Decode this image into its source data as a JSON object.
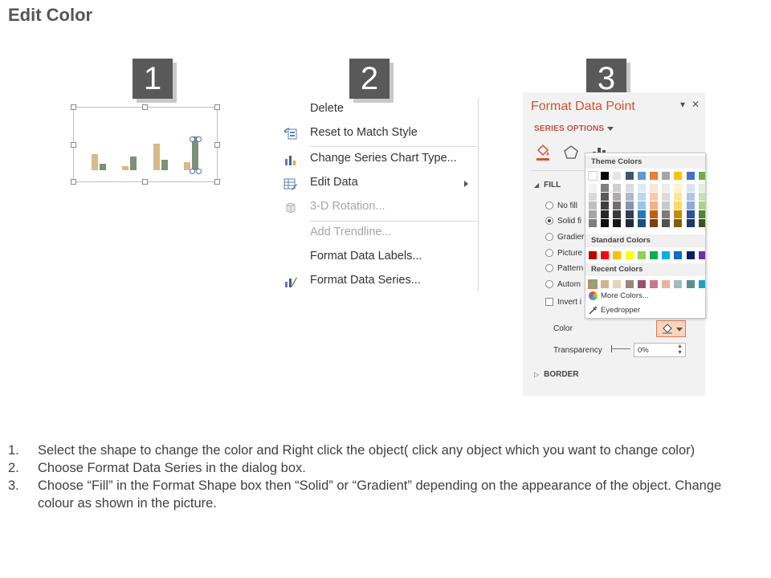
{
  "page": {
    "title": "Edit Color"
  },
  "badges": [
    "1",
    "2",
    "3"
  ],
  "context_menu": {
    "items": [
      {
        "label": "Delete",
        "icon": "none",
        "disabled": false
      },
      {
        "label": "Reset to Match Style",
        "icon": "reset-style-icon",
        "disabled": false
      },
      {
        "label": "Change Series Chart Type...",
        "icon": "chart-type-icon",
        "disabled": false
      },
      {
        "label": "Edit Data",
        "icon": "edit-data-icon",
        "disabled": false,
        "submenu": true
      },
      {
        "label": "3-D Rotation...",
        "icon": "rotation-icon",
        "disabled": true
      },
      {
        "label": "Add Trendline...",
        "icon": "none",
        "disabled": true
      },
      {
        "label": "Format Data Labels...",
        "icon": "none",
        "disabled": false
      },
      {
        "label": "Format Data Series...",
        "icon": "format-series-icon",
        "disabled": false
      }
    ]
  },
  "format_pane": {
    "title": "Format Data Point",
    "series_options": "SERIES OPTIONS",
    "fill_heading": "FILL",
    "fill_options": [
      {
        "label": "No fill",
        "selected": false
      },
      {
        "label": "Solid fi",
        "selected": true
      },
      {
        "label": "Gradier",
        "selected": false
      },
      {
        "label": "Picture",
        "selected": false
      },
      {
        "label": "Pattern",
        "selected": false
      },
      {
        "label": "Autom",
        "selected": false
      }
    ],
    "invert_label": "Invert i",
    "color_label": "Color",
    "transparency_label": "Transparency",
    "transparency_value": "0%",
    "border_heading": "BORDER",
    "accent_color": "#d35230"
  },
  "color_dropdown": {
    "theme_heading": "Theme Colors",
    "standard_heading": "Standard Colors",
    "recent_heading": "Recent Colors",
    "more_colors": "More Colors...",
    "eyedropper": "Eyedropper",
    "theme_top": [
      "#ffffff",
      "#000000",
      "#e7e6e6",
      "#44546a",
      "#5b9bd5",
      "#ed7d31",
      "#a5a5a5",
      "#ffc000",
      "#4472c4",
      "#70ad47"
    ],
    "theme_shades": [
      [
        "#f2f2f2",
        "#7f7f7f",
        "#d0cece",
        "#d6dce4",
        "#deebf6",
        "#fbe5d5",
        "#ededed",
        "#fff2cc",
        "#dae3f3",
        "#e2efd9"
      ],
      [
        "#d8d8d8",
        "#595959",
        "#aeabab",
        "#adb9ca",
        "#bdd7ee",
        "#f7cbac",
        "#dbdbdb",
        "#fee599",
        "#b4c6e7",
        "#c5e0b3"
      ],
      [
        "#bfbfbf",
        "#3f3f3f",
        "#757070",
        "#8496b0",
        "#9cc3e5",
        "#f4b183",
        "#c9c9c9",
        "#ffd965",
        "#8eaadb",
        "#a8d08d"
      ],
      [
        "#a5a5a5",
        "#262626",
        "#3a3838",
        "#323f4f",
        "#2e75b5",
        "#c55a11",
        "#7b7b7b",
        "#bf9000",
        "#2f5496",
        "#538135"
      ],
      [
        "#7f7f7f",
        "#0c0c0c",
        "#171616",
        "#222a35",
        "#1e4e79",
        "#833c0b",
        "#525252",
        "#7f6000",
        "#1f3864",
        "#375623"
      ]
    ],
    "standard": [
      "#c00000",
      "#ff0000",
      "#ffc000",
      "#ffff00",
      "#92d050",
      "#00b050",
      "#00b0f0",
      "#0070c0",
      "#002060",
      "#7030a0"
    ],
    "recent": [
      "#8fa37e",
      "#d2b48c",
      "#e3d5b8",
      "#9c8578",
      "#9c4f6a",
      "#c97b85",
      "#e8b4a0",
      "#9dbdb8",
      "#5a8f8f",
      "#1fa0c8"
    ]
  },
  "instructions": [
    {
      "num": "1.",
      "text": "Select the shape to change the color and Right click the object( click any object which you want to change color)"
    },
    {
      "num": "2.",
      "text": "Choose Format Data Series in the dialog box."
    },
    {
      "num": "3.",
      "text": "Choose “Fill” in the Format Shape box then “Solid” or “Gradient” depending on the appearance of the object. Change colour as shown in the picture."
    }
  ]
}
